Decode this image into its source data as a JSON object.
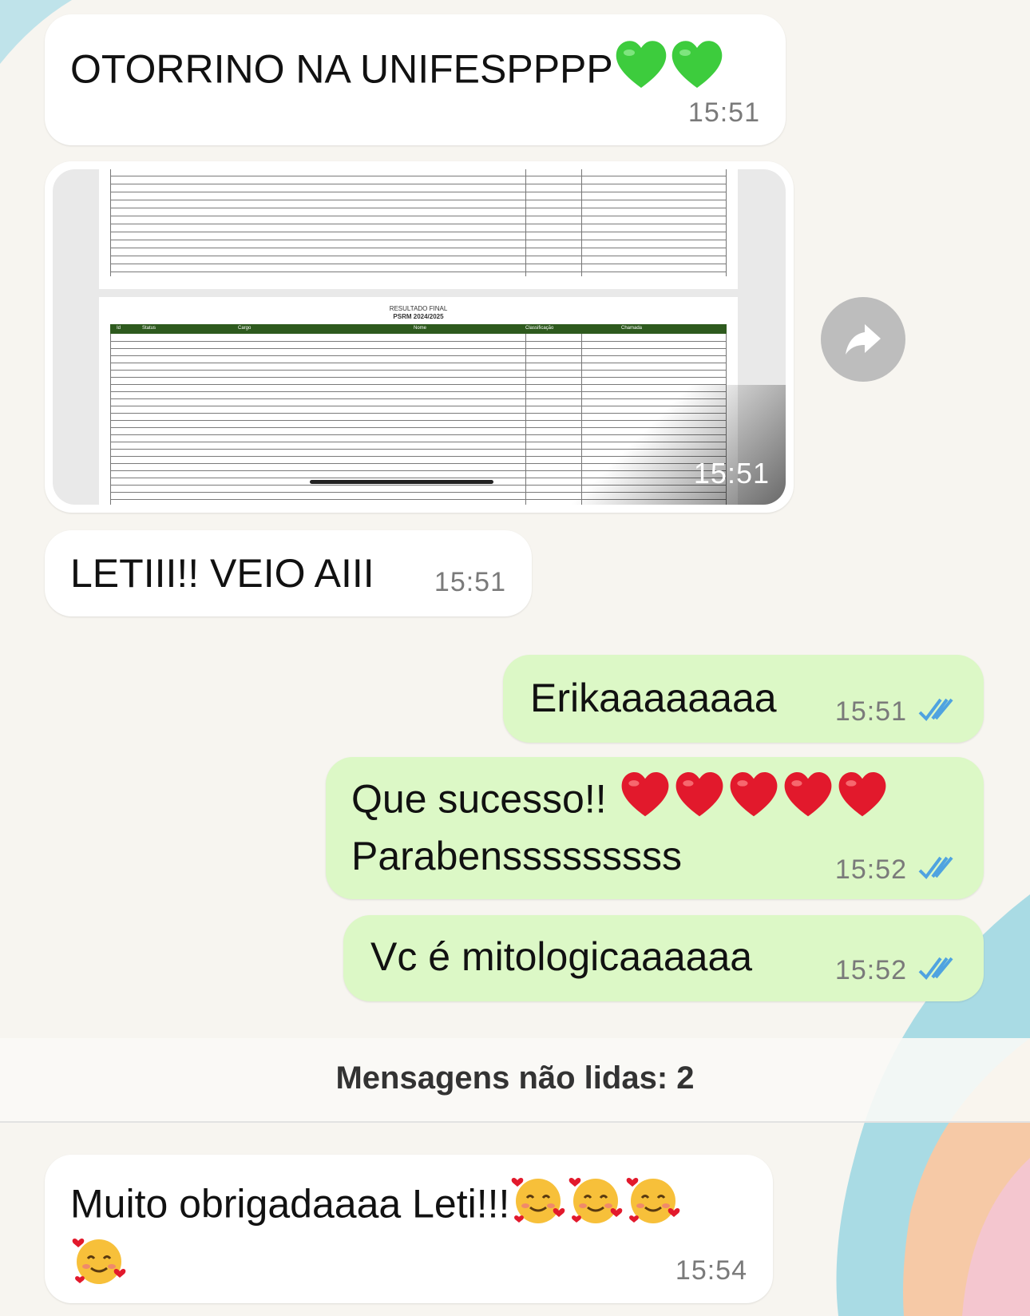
{
  "colors": {
    "incoming_bubble": "#ffffff",
    "outgoing_bubble": "#dcf8c6",
    "read_ticks": "#4fa3e0",
    "heart_green": "#3dcc3d",
    "heart_red": "#e2192c",
    "sheet_header": "#2e5a1e"
  },
  "messages": [
    {
      "id": "m1",
      "direction": "incoming",
      "text": "OTORRINO NA UNIFESPPPP",
      "emojis": [
        "green-heart",
        "green-heart"
      ],
      "time": "15:51"
    },
    {
      "id": "m2",
      "direction": "incoming",
      "type": "image",
      "time": "15:51",
      "image": {
        "title": "RESULTADO FINAL",
        "subtitle": "PSRM 2024/2025",
        "columns": [
          "Id",
          "Status",
          "Cargo",
          "Nome",
          "Classificação",
          "Chamada"
        ]
      },
      "action_icon": "forward-icon"
    },
    {
      "id": "m3",
      "direction": "incoming",
      "text": "LETIII!! VEIO AIII",
      "time": "15:51"
    },
    {
      "id": "m4",
      "direction": "outgoing",
      "text": "Erikaaaaaaaa",
      "time": "15:51",
      "status": "read"
    },
    {
      "id": "m5",
      "direction": "outgoing",
      "line1": "Que sucesso!!",
      "emojis": [
        "red-heart",
        "red-heart",
        "red-heart",
        "red-heart",
        "red-heart"
      ],
      "line2": "Parabensssssssss",
      "time": "15:52",
      "status": "read"
    },
    {
      "id": "m6",
      "direction": "outgoing",
      "text": "Vc é mitologicaaaaaa",
      "time": "15:52",
      "status": "read"
    },
    {
      "id": "m7",
      "direction": "incoming",
      "text": "Muito obrigadaaaa Leti!!!",
      "emojis": [
        "smiling-face-with-hearts",
        "smiling-face-with-hearts",
        "smiling-face-with-hearts",
        "smiling-face-with-hearts"
      ],
      "time": "15:54"
    }
  ],
  "unread_divider": "Mensagens não lidas: 2"
}
